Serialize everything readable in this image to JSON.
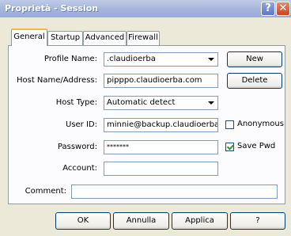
{
  "window": {
    "title": "Proprietà - Session",
    "help_label": "?",
    "close_label": "✕"
  },
  "tabs": [
    {
      "label": "General",
      "active": true
    },
    {
      "label": "Startup",
      "active": false
    },
    {
      "label": "Advanced",
      "active": false
    },
    {
      "label": "Firewall",
      "active": false
    }
  ],
  "form": {
    "profile_name_label": "Profile Name:",
    "profile_name_value": ".claudioerba",
    "host_label": "Host Name/Address:",
    "host_value": "pipppo.claudioerba.com",
    "host_type_label": "Host Type:",
    "host_type_value": "Automatic detect",
    "user_id_label": "User ID:",
    "user_id_value": "minnie@backup.claudioerba.co",
    "password_label": "Password:",
    "password_value": "*******",
    "account_label": "Account:",
    "account_value": "",
    "comment_label": "Comment:",
    "comment_value": ""
  },
  "side_buttons": {
    "new_label": "New",
    "delete_label": "Delete"
  },
  "checkboxes": {
    "anonymous_label": "Anonymous",
    "anonymous_checked": false,
    "save_pwd_label": "Save Pwd",
    "save_pwd_checked": true
  },
  "footer": {
    "ok_label": "OK",
    "cancel_label": "Annulla",
    "apply_label": "Applica",
    "help_label": "?"
  },
  "colors": {
    "title_bar": "#a6b6dc",
    "close_button": "#c8451f",
    "dialog_bg": "#ece9d8"
  }
}
